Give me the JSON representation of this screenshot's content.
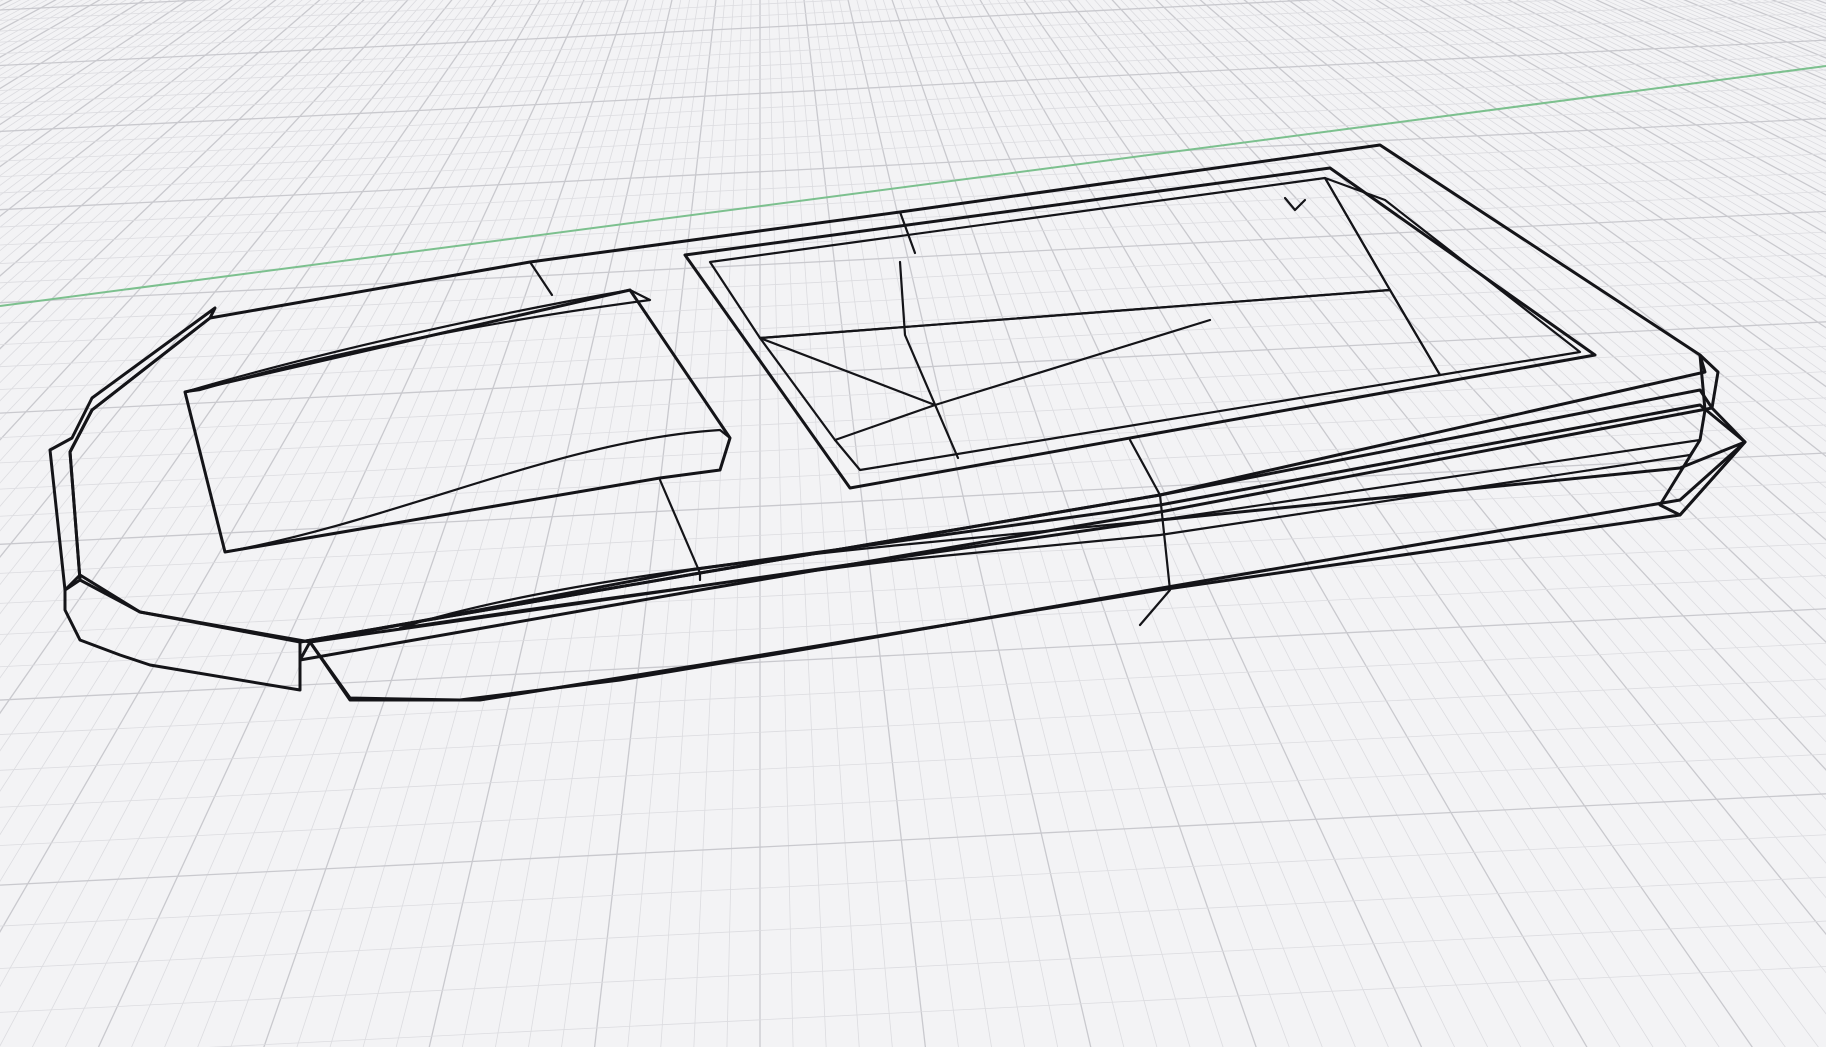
{
  "viewport": {
    "background_color": "#f3f3f5",
    "grid_minor_color": "#dcdce0",
    "grid_major_color": "#c9c9ce",
    "axis_color": "#7cc08e",
    "grid_visible": true
  },
  "model": {
    "shading_dark": "#5e5d63",
    "shading_mid": "#727177",
    "shading_light": "#8b8a90",
    "shading_pale": "#a09fa6",
    "edge_color": "#141418"
  }
}
